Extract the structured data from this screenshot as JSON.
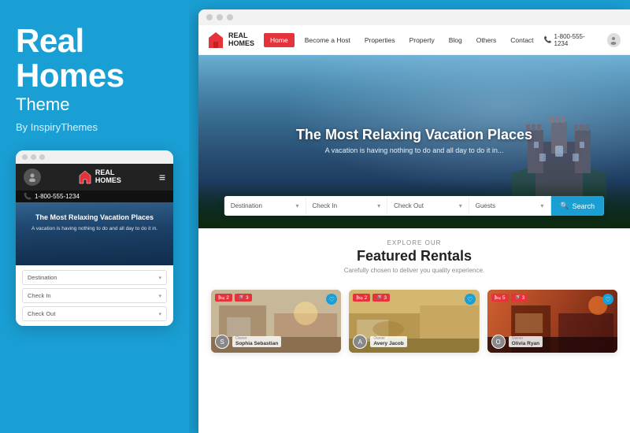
{
  "left": {
    "title_line1": "Real",
    "title_line2": "Homes",
    "subtitle": "Theme",
    "by": "By InspiryThemes"
  },
  "mobile": {
    "phone": "1-800-555-1234",
    "hero_title": "The Most Relaxing Vacation Places",
    "hero_sub": "A vacation is having nothing to do and all day to do it in.",
    "search_fields": [
      "Destination",
      "Check In",
      "Check Out"
    ]
  },
  "nav": {
    "logo_line1": "REAL",
    "logo_line2": "HOMES",
    "items": [
      "Home",
      "Become a Host",
      "Properties",
      "Property",
      "Blog",
      "Others",
      "Contact"
    ],
    "active_item": "Home",
    "phone": "1-800-555-1234"
  },
  "hero": {
    "title": "The Most Relaxing Vacation Places",
    "subtitle": "A vacation is having nothing to do and all day to do it in...",
    "search": {
      "destination_label": "Destination",
      "checkin_label": "Check In",
      "checkout_label": "Check Out",
      "guests_label": "Guests",
      "button_label": "Search"
    }
  },
  "featured": {
    "explore_label": "Explore Our",
    "title": "Featured Rentals",
    "description": "Carefully chosen to deliver you quality experience."
  },
  "cards": [
    {
      "badges": [
        "2",
        "3"
      ],
      "owner_label": "Owner",
      "owner_name": "Sophia Sebastian",
      "fav": true
    },
    {
      "badges": [
        "2",
        "3"
      ],
      "owner_label": "Owner",
      "owner_name": "Avery Jacob",
      "fav": true
    },
    {
      "badges": [
        "5",
        "3"
      ],
      "owner_label": "Owner",
      "owner_name": "Olivia Ryan",
      "fav": true
    }
  ],
  "colors": {
    "accent_blue": "#1a9fd4",
    "accent_red": "#e5323b"
  }
}
